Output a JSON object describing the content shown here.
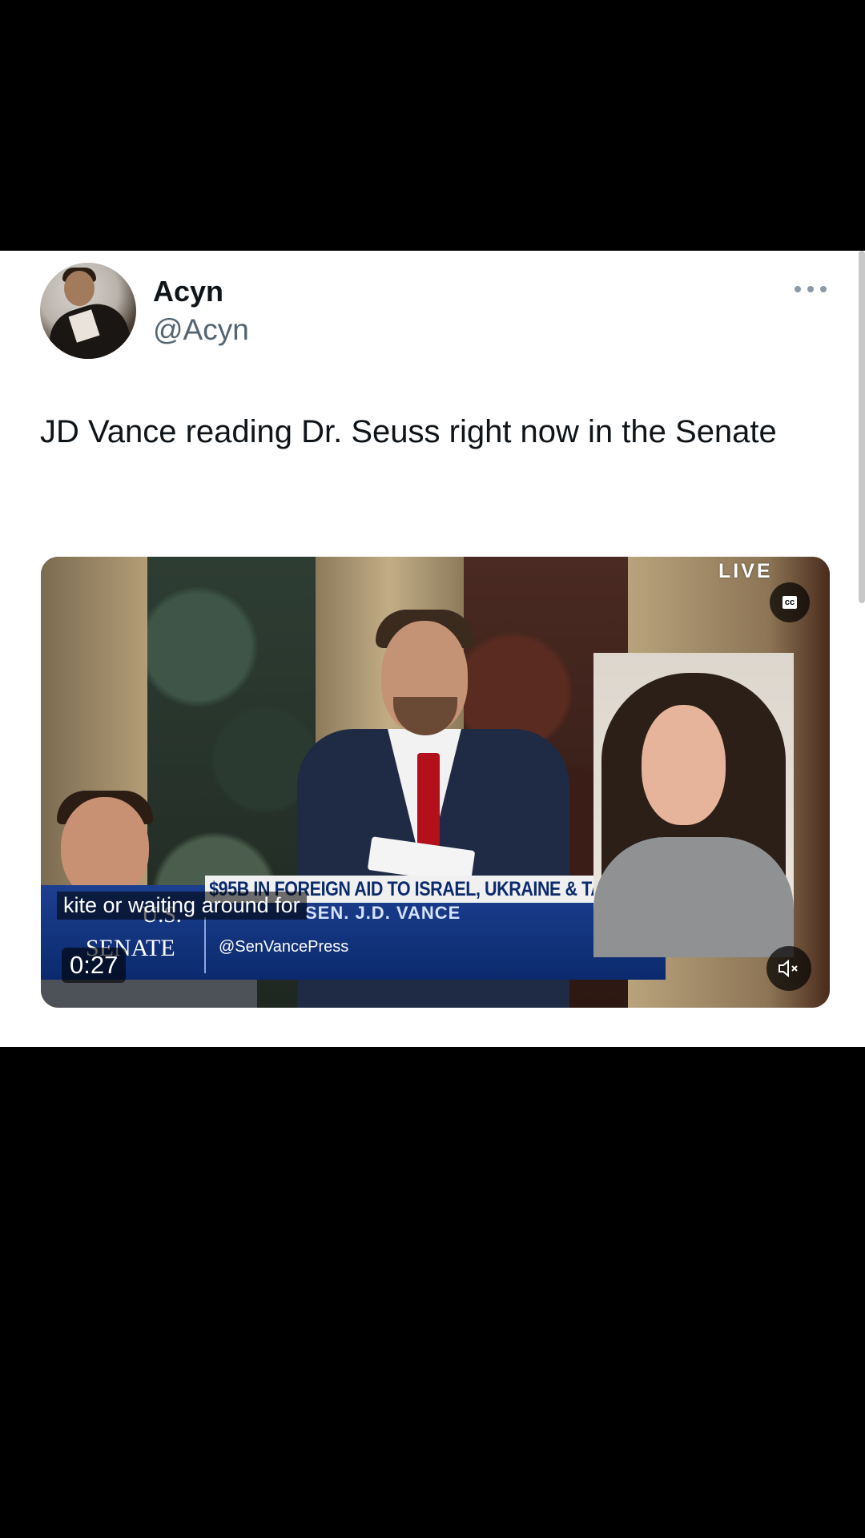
{
  "tweet": {
    "author_name": "Acyn",
    "author_handle": "@Acyn",
    "text": "JD Vance reading Dr. Seuss right now in the Senate",
    "more_icon": "more-options-icon"
  },
  "video": {
    "live_badge": "LIVE",
    "cc_label": "cc",
    "chyron_headline": "$95B IN FOREIGN AID TO ISRAEL, UKRAINE & TA",
    "chyron_name": "SEN. J.D. VANCE",
    "chyron_handle": "@SenVancePress",
    "network_logo_top": "U.S.",
    "network_logo_bottom": "SENATE",
    "caption": "kite or waiting around for",
    "timestamp": "0:27",
    "mute_icon": "speaker-muted-icon"
  },
  "colors": {
    "background": "#000000",
    "card": "#ffffff",
    "name_text": "#0f1419",
    "handle_text": "#536471",
    "chyron_blue": "#0b2a6e"
  }
}
